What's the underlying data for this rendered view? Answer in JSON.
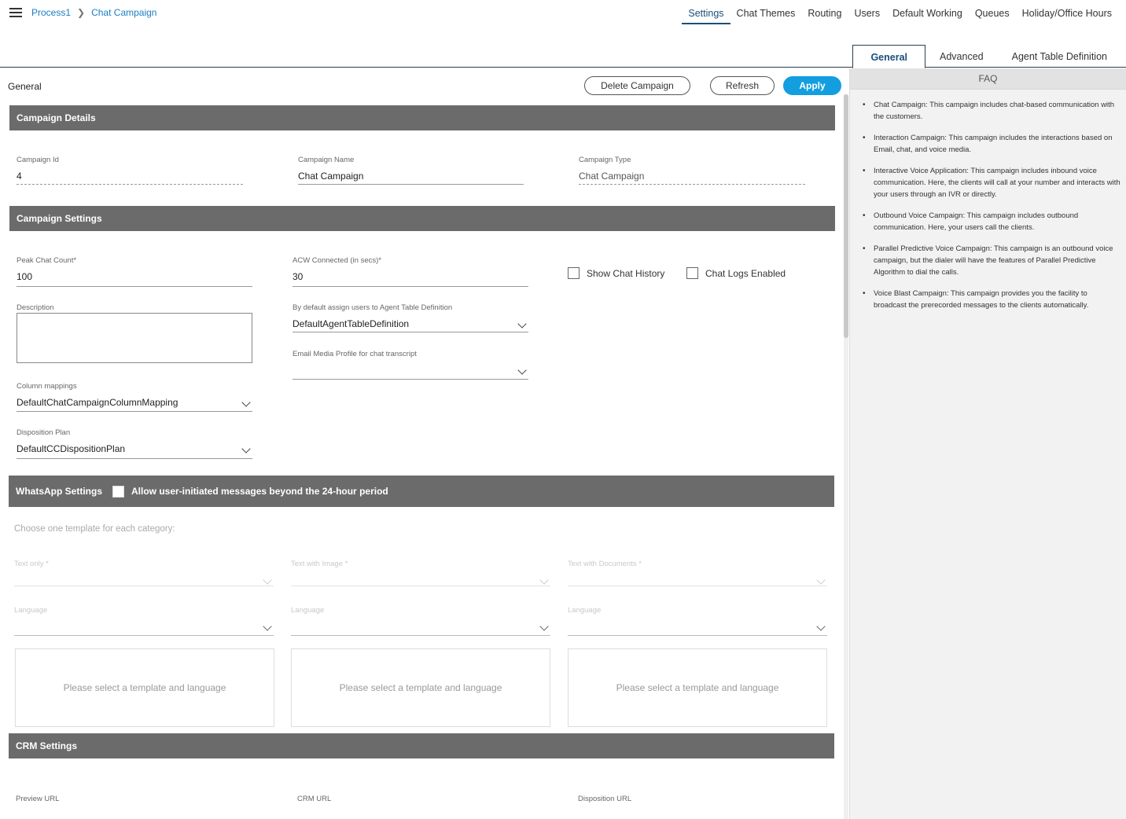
{
  "breadcrumb": {
    "parent": "Process1",
    "current": "Chat Campaign"
  },
  "topnav": [
    "Settings",
    "Chat Themes",
    "Routing",
    "Users",
    "Default Working",
    "Queues",
    "Holiday/Office Hours"
  ],
  "subtabs": [
    "General",
    "Advanced",
    "Agent Table Definition"
  ],
  "page_label": "General",
  "buttons": {
    "delete": "Delete Campaign",
    "refresh": "Refresh",
    "apply": "Apply"
  },
  "campaign_details": {
    "header": "Campaign Details",
    "campaign_id": {
      "label": "Campaign Id",
      "value": "4"
    },
    "campaign_name": {
      "label": "Campaign Name",
      "value": "Chat Campaign"
    },
    "campaign_type": {
      "label": "Campaign Type",
      "value": "Chat Campaign"
    }
  },
  "campaign_settings": {
    "header": "Campaign Settings",
    "peak_chat_count": {
      "label": "Peak Chat Count*",
      "value": "100"
    },
    "acw_connected": {
      "label": "ACW Connected (in secs)*",
      "value": "30"
    },
    "show_chat_history": "Show Chat History",
    "chat_logs_enabled": "Chat Logs Enabled",
    "description": {
      "label": "Description"
    },
    "agent_table_def": {
      "label": "By default assign users to Agent Table Definition",
      "value": "DefaultAgentTableDefinition"
    },
    "email_media_profile": {
      "label": "Email Media Profile for chat transcript",
      "value": ""
    },
    "column_mappings": {
      "label": "Column mappings",
      "value": "DefaultChatCampaignColumnMapping"
    },
    "disposition_plan": {
      "label": "Disposition Plan",
      "value": "DefaultCCDispositionPlan"
    }
  },
  "whatsapp": {
    "header": "WhatsApp Settings",
    "allow_label": "Allow user-initiated messages beyond the 24-hour period",
    "hint": "Choose one template for each category:",
    "text_only": "Text only *",
    "text_image": "Text with Image *",
    "text_docs": "Text with Documents *",
    "language": "Language",
    "placeholder": "Please select a template and language"
  },
  "crm": {
    "header": "CRM Settings",
    "preview_url": "Preview URL",
    "crm_url": "CRM URL",
    "disposition_url": "Disposition URL"
  },
  "faq": {
    "title": "FAQ",
    "items": [
      "Chat Campaign: This campaign includes chat-based communication with the customers.",
      "Interaction Campaign: This campaign includes the interactions based on Email, chat, and voice media.",
      "Interactive Voice Application: This campaign includes inbound voice communication. Here, the clients will call at your number and interacts with your users through an IVR or directly.",
      "Outbound Voice Campaign: This campaign includes outbound communication. Here, your users call the clients.",
      "Parallel Predictive Voice Campaign: This campaign is an outbound voice campaign, but the dialer will have the features of Parallel Predictive Algorithm to dial the calls.",
      "Voice Blast Campaign: This campaign provides you the facility to broadcast the prerecorded messages to the clients automatically."
    ]
  },
  "colors": {
    "accent": "#139ee0",
    "link": "#1a7fc1",
    "section_header": "#6b6b6b",
    "nav_active": "#1a4f7a"
  }
}
